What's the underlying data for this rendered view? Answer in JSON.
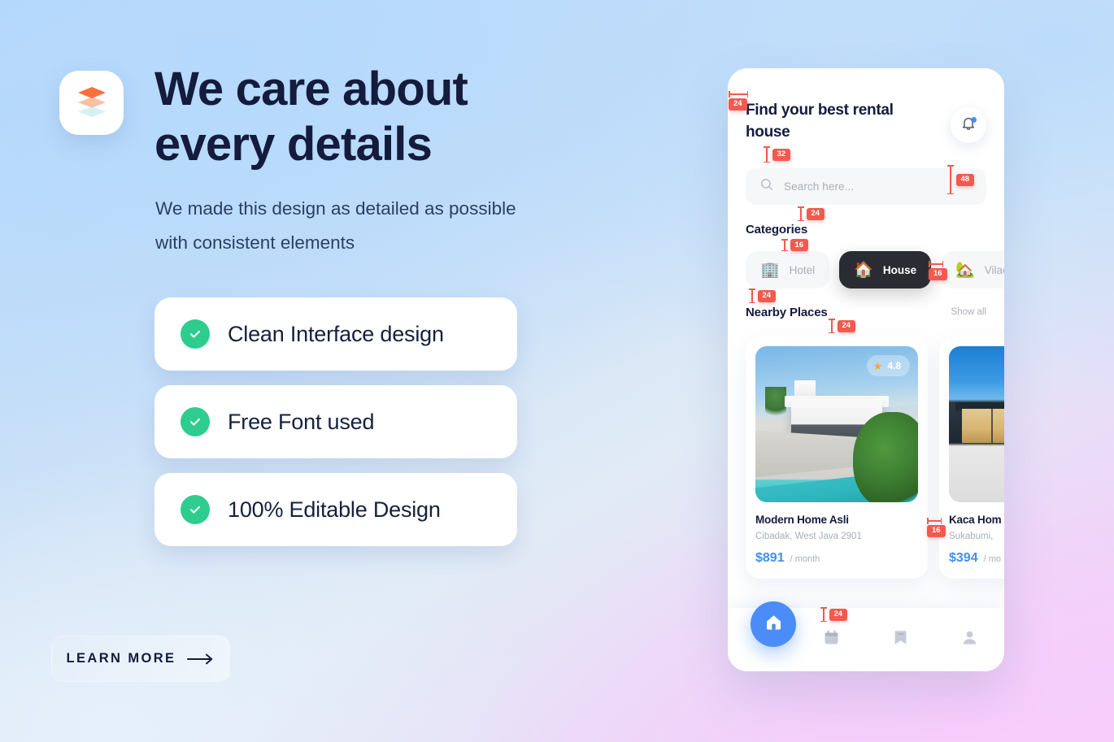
{
  "background": {
    "corner_top_left": "#b5d9fc",
    "corner_bottom_right": "#f6ccfb",
    "corner_bottom_left": "#e3edf7"
  },
  "left": {
    "logo_icon": "layers-stack-icon",
    "headline": "We care about every details",
    "subhead": "We made this design as detailed as possible with consistent elements",
    "features": [
      {
        "label": "Clean Interface design",
        "icon": "check-circle-icon"
      },
      {
        "label": "Free Font used",
        "icon": "check-circle-icon"
      },
      {
        "label": "100% Editable Design",
        "icon": "check-circle-icon"
      }
    ],
    "cta": {
      "label": "LEARN MORE",
      "icon": "arrow-right-icon"
    },
    "colors": {
      "headline": "#141b3d",
      "check": "#2ecc8f",
      "card_bg": "#ffffff"
    }
  },
  "phone": {
    "title": "Find your best rental house",
    "bell_icon": "bell-icon",
    "bell_has_unread": true,
    "search": {
      "placeholder": "Search here...",
      "value": "",
      "icon": "search-icon"
    },
    "categories_heading": "Categories",
    "categories": [
      {
        "label": "Hotel",
        "emoji": "🏢",
        "active": false
      },
      {
        "label": "House",
        "emoji": "🏠",
        "active": true
      },
      {
        "label": "Vilac",
        "emoji": "🏡",
        "active": false
      }
    ],
    "nearby_heading": "Nearby Places",
    "show_all": "Show all",
    "properties": [
      {
        "name": "Modern Home Asli",
        "location": "Cibadak,  West Java 2901",
        "price": "$891",
        "period": "/ month",
        "rating": "4.8",
        "star_icon": "star-icon"
      },
      {
        "name": "Kaca Hom",
        "location": "Sukabumi, ",
        "price": "$394",
        "period": "/ mo",
        "rating": "",
        "star_icon": "star-icon"
      }
    ],
    "nav": [
      {
        "icon": "home-icon",
        "label": "Home",
        "active": true
      },
      {
        "icon": "calendar-icon",
        "label": "Calendar",
        "active": false
      },
      {
        "icon": "bookmark-icon",
        "label": "Saved",
        "active": false
      },
      {
        "icon": "person-icon",
        "label": "Profile",
        "active": false
      }
    ],
    "colors": {
      "accent_blue": "#4b8df8",
      "price_blue": "#3f8ff4",
      "active_chip": "#2b2b33",
      "muted": "#a8aeb9"
    }
  },
  "measurements": {
    "badge_color": "#f4594f",
    "items": [
      {
        "id": "m-top-padding",
        "value": "24"
      },
      {
        "id": "m-title-to-search",
        "value": "32"
      },
      {
        "id": "m-search-height",
        "value": "48"
      },
      {
        "id": "m-search-to-cat",
        "value": "24"
      },
      {
        "id": "m-cat-heading-gap",
        "value": "16"
      },
      {
        "id": "m-chip-gap",
        "value": "16"
      },
      {
        "id": "m-cat-to-nearby",
        "value": "24"
      },
      {
        "id": "m-nearby-to-cards",
        "value": "24"
      },
      {
        "id": "m-card-gap",
        "value": "16"
      },
      {
        "id": "m-nav-padding",
        "value": "24"
      }
    ]
  }
}
